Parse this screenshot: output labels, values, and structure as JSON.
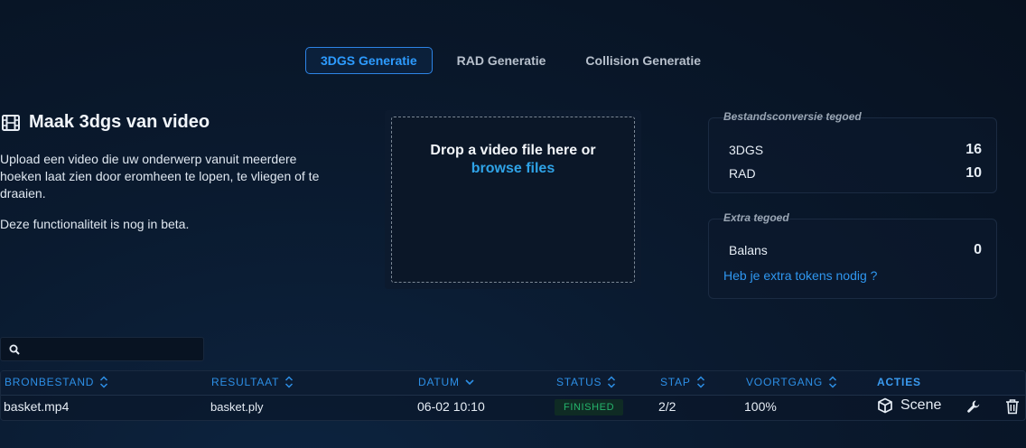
{
  "tabs": [
    {
      "label": "3DGS Generatie",
      "active": true
    },
    {
      "label": "RAD Generatie",
      "active": false
    },
    {
      "label": "Collision Generatie",
      "active": false
    }
  ],
  "intro": {
    "title": "Maak 3dgs van video",
    "description": "Upload een video die uw onderwerp vanuit meerdere hoeken laat zien door eromheen te lopen, te vliegen of te draaien.",
    "beta_note": "Deze functionaliteit is nog in beta."
  },
  "dropzone": {
    "text": "Drop a video file here or",
    "browse_label": "browse files"
  },
  "credits": {
    "title": "Bestandsconversie tegoed",
    "rows": [
      {
        "label": "3DGS",
        "value": "16"
      },
      {
        "label": "RAD",
        "value": "10"
      }
    ]
  },
  "extra": {
    "title": "Extra tegoed",
    "balance_label": "Balans",
    "balance_value": "0",
    "link": "Heb je extra tokens nodig ?"
  },
  "search": {
    "value": "",
    "placeholder": ""
  },
  "table": {
    "headers": {
      "source": "BRONBESTAND",
      "result": "RESULTAAT",
      "date": "DATUM",
      "status": "STATUS",
      "step": "STAP",
      "progress": "VOORTGANG",
      "actions": "ACTIES"
    },
    "rows": [
      {
        "source": "basket.mp4",
        "result": "basket.ply",
        "date": "06-02 10:10",
        "status": "FINISHED",
        "step": "2/2",
        "progress": "100%",
        "scene_label": "Scene"
      }
    ]
  },
  "colors": {
    "accent": "#2d9bff",
    "status_finished": "#25b56c",
    "background": "#0a1a2f"
  },
  "icons": [
    "film-icon",
    "search-icon",
    "sort-icon",
    "chevron-down-icon",
    "cube-icon",
    "wrench-icon",
    "trash-icon"
  ]
}
